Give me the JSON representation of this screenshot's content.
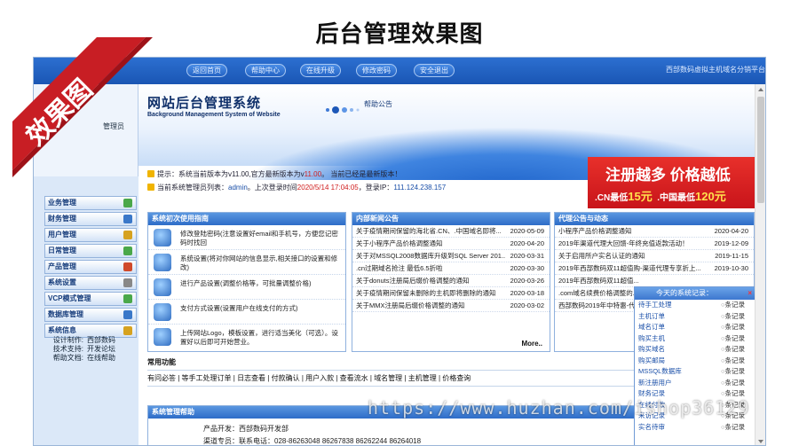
{
  "page_title": "后台管理效果图",
  "ribbon_text": "效果图",
  "topnav": {
    "buttons": [
      "返回首页",
      "帮助中心",
      "在线升级",
      "修改密码",
      "安全退出"
    ],
    "site_tag": "西部数码虚拟主机域名分销平台"
  },
  "header": {
    "logo_cn": "网站后台管理系统",
    "logo_en": "Background Management System of Website",
    "notice": "帮助公告"
  },
  "sidebar": {
    "login_hint": "管理员",
    "items": [
      "业务管理",
      "财务管理",
      "用户管理",
      "日常管理",
      "产品管理",
      "系统设置",
      "VCP模式管理",
      "数据库管理",
      "系统信息"
    ],
    "info": [
      {
        "k": "设计制作:",
        "v": "西部数码"
      },
      {
        "k": "技术支持:",
        "v": "开发论坛"
      },
      {
        "k": "帮助文档:",
        "v": "在线帮助"
      }
    ]
  },
  "tips": {
    "line1_pre": "提示：系统当前版本为v11.00,官方最新版本为v",
    "line1_ver": "11.00",
    "line1_post": "。 当前已经是最新版本！",
    "line2_pre": "当前系统管理员列表：",
    "line2_admin": "admin",
    "line2_mid": "。上次登录时间",
    "line2_time": "2020/5/14 17:04:05",
    "line2_ip_label": "，登录IP：",
    "line2_ip": "111.124.238.157"
  },
  "promo": {
    "line1": "注册越多  价格越低",
    "cn_label": ".CN最低",
    "cn_price": "15元",
    "zgcn_label": ".中国最低",
    "zgcn_price": "120元"
  },
  "guide": {
    "title": "系统初次使用指南",
    "rows": [
      "修改登陆密码(注意设置好email和手机号，方便您记密码时找回",
      "系统设置(将对你网站的信息显示,相关接口的设置和修改)",
      "进行产品设置(调整价格等，可批量调整价格)",
      "支付方式设置(设置用户在线支付的方式)",
      "上传网站Logo，模板设置，进行适当美化（可选）。设置好以后即可开始营业。"
    ]
  },
  "news": {
    "title": "内部新闻公告",
    "rows": [
      {
        "t": "关于疫情期间保留的海北省.CN、.中国域名即将...",
        "d": "2020-05-09"
      },
      {
        "t": "关于小程序产品价格调整通知",
        "d": "2020-04-20"
      },
      {
        "t": "关于对MSSQL2008数据库升级到SQL Server 201..",
        "d": "2020-03-31"
      },
      {
        "t": ".cn过期域名抢注 最低6.5折啦",
        "d": "2020-03-30"
      },
      {
        "t": "关于donuts注册局后缀价格调整的通知",
        "d": "2020-03-26"
      },
      {
        "t": "关于疫情期间保留未删除的主机即将删除的通知",
        "d": "2020-03-18"
      },
      {
        "t": "关于MMX注册局后缀价格调整的通知",
        "d": "2020-03-02"
      }
    ],
    "more": "More.."
  },
  "agent": {
    "title": "代理公告与动态",
    "rows": [
      {
        "t": "小程序产品价格调整通知",
        "d": "2020-04-20"
      },
      {
        "t": "2019年渠道代理大回馈-年终充值返款活动！",
        "d": "2019-12-09"
      },
      {
        "t": "关于启用所户实名认证的通知",
        "d": "2019-11-15"
      },
      {
        "t": "2019年西部数码双11超值购-渠道代理专享折上...",
        "d": "2019-10-30"
      },
      {
        "t": "2019年西部数码双11超值...",
        "d": ""
      },
      {
        "t": ".com域名续费价格调整的...",
        "d": ""
      },
      {
        "t": "西部数码2019年中特惠-代...",
        "d": ""
      }
    ]
  },
  "popup": {
    "title": "今天的系统记录：",
    "close": "×",
    "rows": [
      {
        "k": "待手工处理",
        "c": "条记录"
      },
      {
        "k": "主机订单",
        "c": "条记录"
      },
      {
        "k": "域名订单",
        "c": "条记录"
      },
      {
        "k": "购买主机",
        "c": "条记录"
      },
      {
        "k": "购买域名",
        "c": "条记录"
      },
      {
        "k": "购买邮局",
        "c": "条记录"
      },
      {
        "k": "MSSQL数据库",
        "c": "条记录"
      },
      {
        "k": "新注册用户",
        "c": "条记录"
      },
      {
        "k": "财务记录",
        "c": "条记录"
      },
      {
        "k": "在线付款",
        "c": "条记录"
      },
      {
        "k": "来访记录",
        "c": "条记录"
      },
      {
        "k": "实名待审",
        "c": "条记录"
      }
    ]
  },
  "common": {
    "caption": "常用功能",
    "links": [
      "有问必答",
      "等手工处理订单",
      "日志查看",
      "付款确认",
      "用户入款",
      "查看流水",
      "域名管理",
      "主机管理",
      "价格查询"
    ]
  },
  "help_panel": {
    "title": "系统管理帮助",
    "line1_label": "产品开发：",
    "line1_val": "西部数码开发部",
    "line2_label": "渠道专员：",
    "line2_val": "联系电话：028-86263048 86267838 86262244    86264018"
  },
  "watermark": "https://www.huzhan.com/ishop36129"
}
